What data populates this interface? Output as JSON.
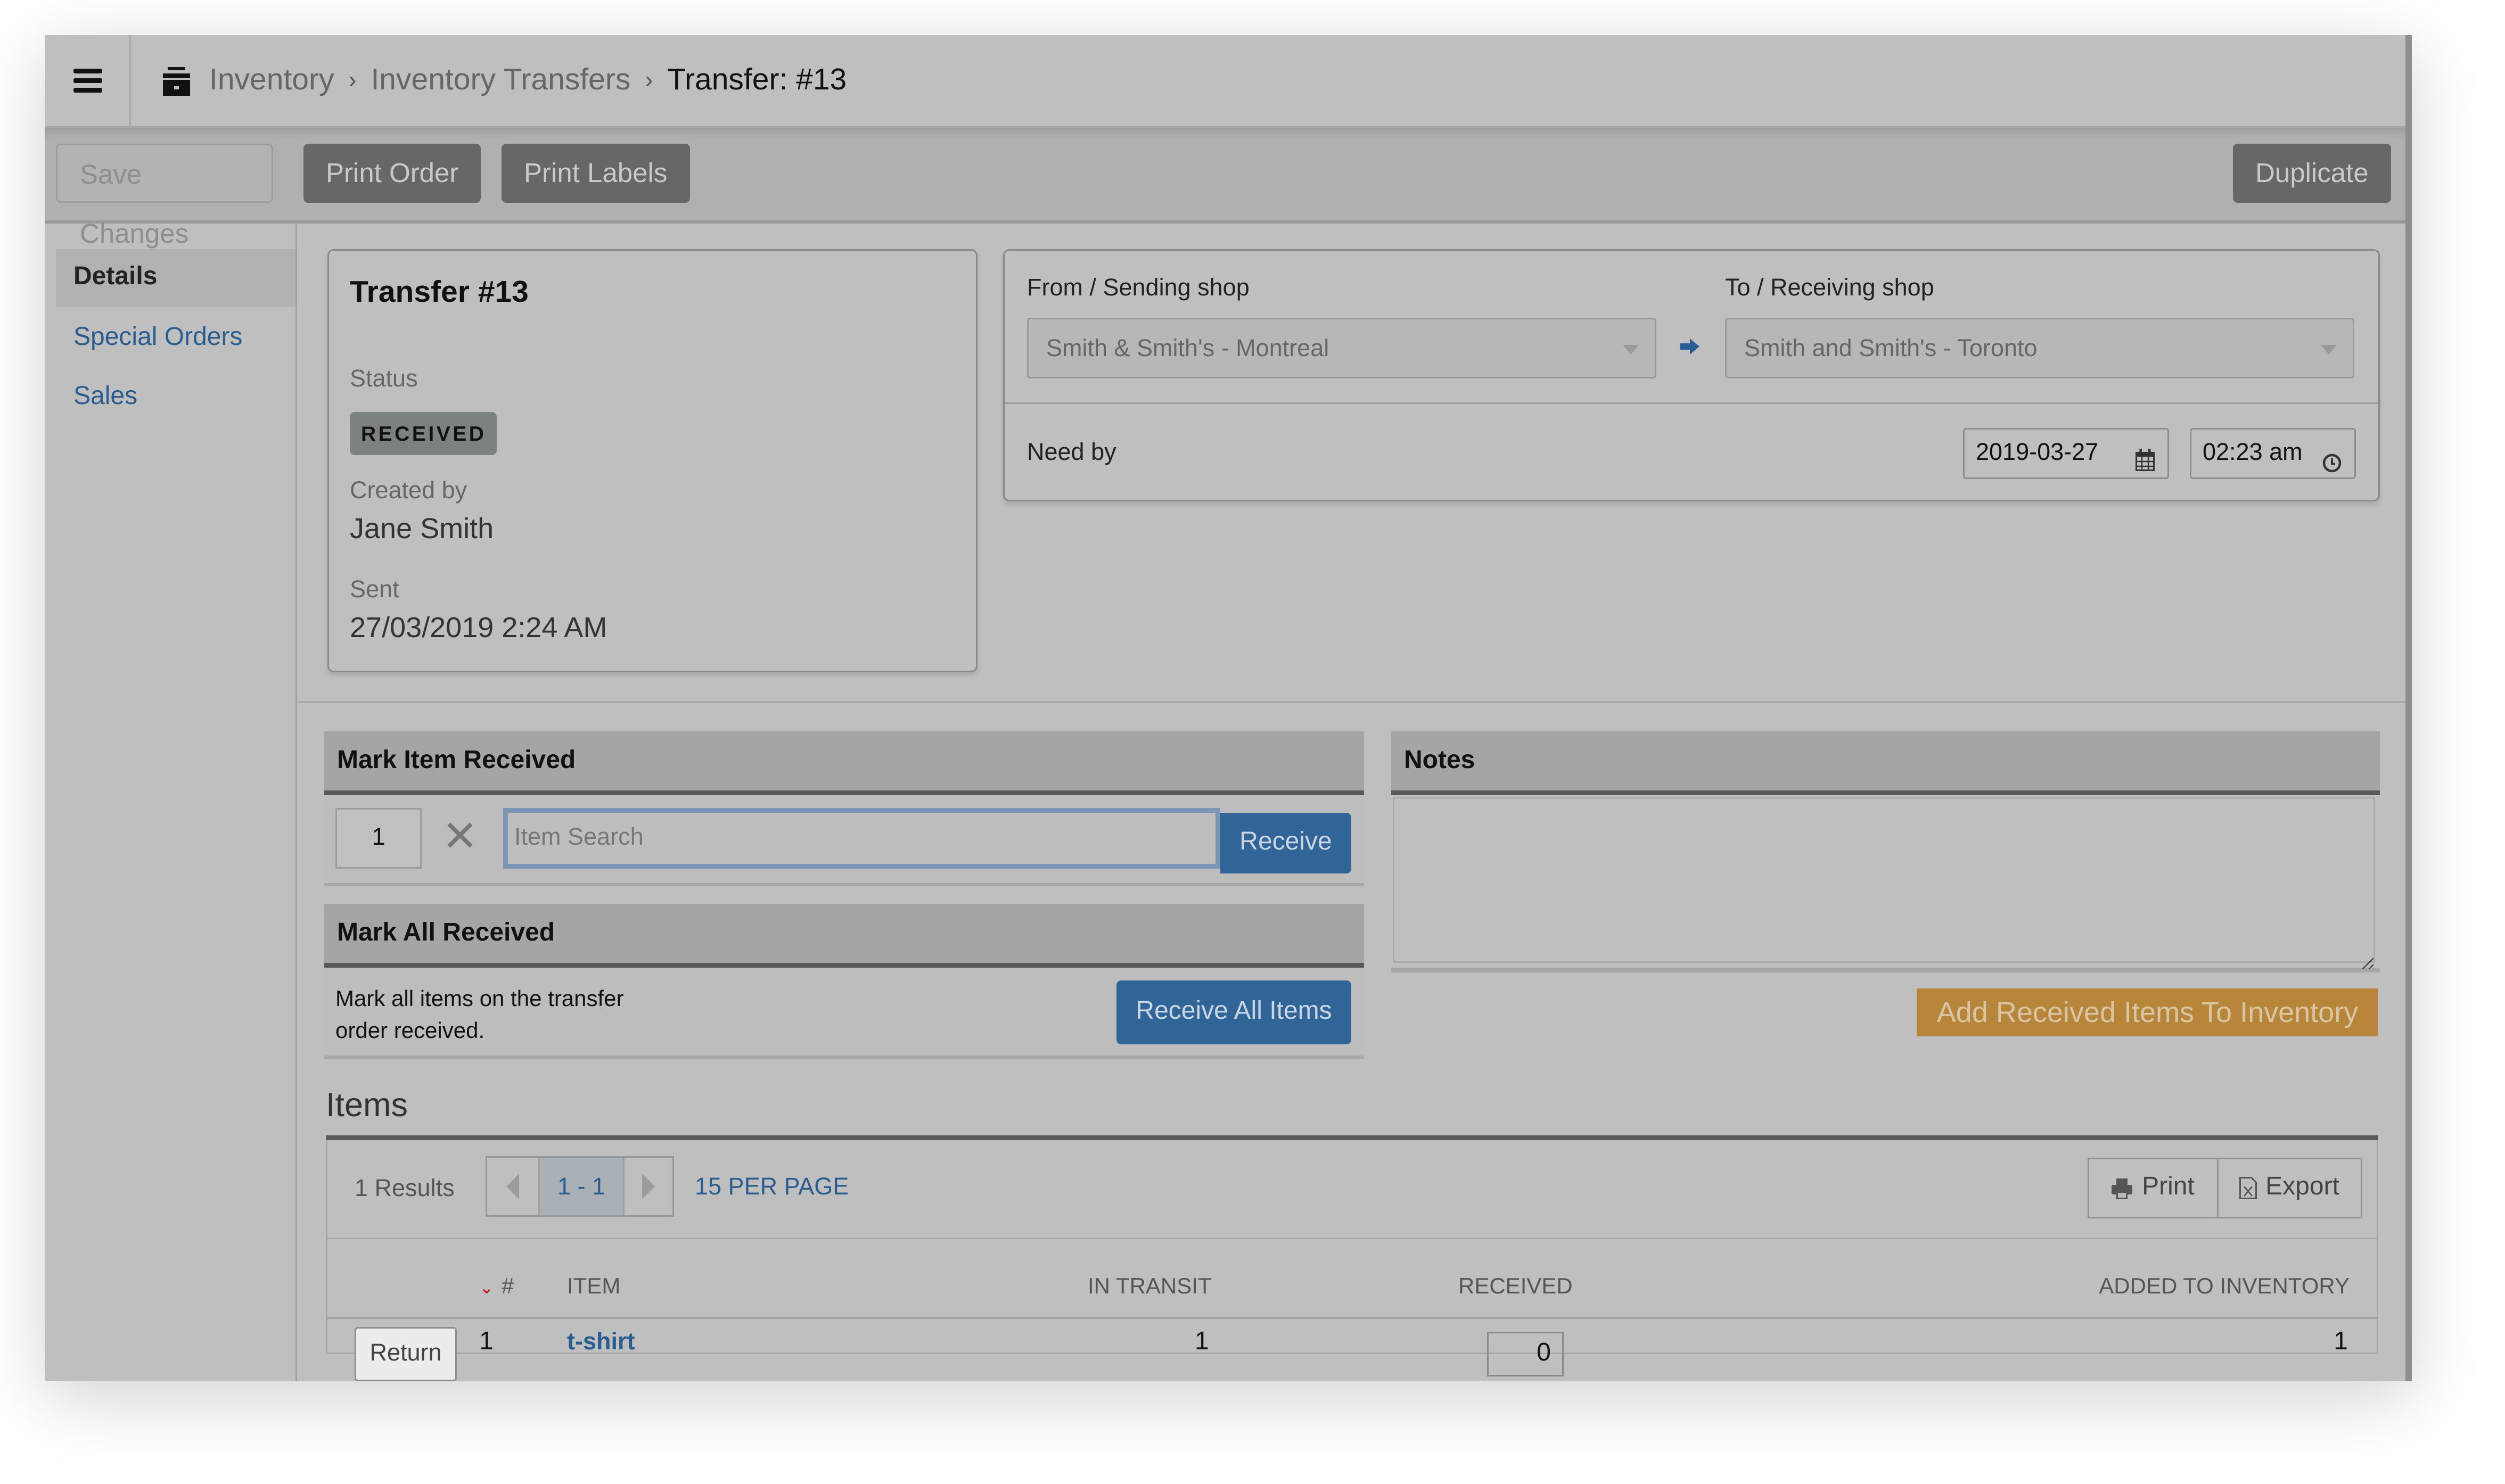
{
  "breadcrumb": {
    "icon": "archive-icon",
    "items": [
      "Inventory",
      "Inventory Transfers"
    ],
    "current": "Transfer: #13",
    "separator": "›"
  },
  "toolbar": {
    "save_label": "Save Changes",
    "print_order_label": "Print Order",
    "print_labels_label": "Print Labels",
    "duplicate_label": "Duplicate"
  },
  "sidebar": {
    "items": [
      {
        "label": "Details",
        "active": true
      },
      {
        "label": "Special Orders",
        "active": false
      },
      {
        "label": "Sales",
        "active": false
      }
    ]
  },
  "transfer": {
    "title": "Transfer #13",
    "status_label": "Status",
    "status": "RECEIVED",
    "created_by_label": "Created by",
    "created_by": "Jane Smith",
    "sent_label": "Sent",
    "sent": "27/03/2019 2:24 AM"
  },
  "shops": {
    "from_label": "From / Sending shop",
    "from_value": "Smith & Smith's - Montreal",
    "to_label": "To / Receiving shop",
    "to_value": "Smith and Smith's - Toronto",
    "arrow_icon": "arrow-right-icon",
    "need_by_label": "Need by",
    "need_by_date": "2019-03-27",
    "need_by_time": "02:23 am"
  },
  "mark_item": {
    "title": "Mark Item Received",
    "quantity": "1",
    "search_placeholder": "Item Search",
    "receive_label": "Receive"
  },
  "mark_all": {
    "title": "Mark All Received",
    "description_line1": "Mark all items on the transfer",
    "description_line2": "order received.",
    "button_label": "Receive All Items"
  },
  "notes": {
    "title": "Notes",
    "value": ""
  },
  "add_to_inventory_label": "Add Received Items To Inventory",
  "items": {
    "title": "Items",
    "results": "1 Results",
    "page_range": "1 - 1",
    "per_page": "15 PER PAGE",
    "print_label": "Print",
    "export_label": "Export",
    "columns": [
      "#",
      "ITEM",
      "IN TRANSIT",
      "RECEIVED",
      "ADDED TO INVENTORY"
    ],
    "rows": [
      {
        "action": "Return",
        "num": "1",
        "item": "t-shirt",
        "in_transit": "1",
        "received": "0",
        "added": "1"
      }
    ]
  },
  "colors": {
    "link": "#2a5d8f",
    "primary": "#316598",
    "warning": "#b8863b",
    "sort_indicator": "#c0161b"
  }
}
